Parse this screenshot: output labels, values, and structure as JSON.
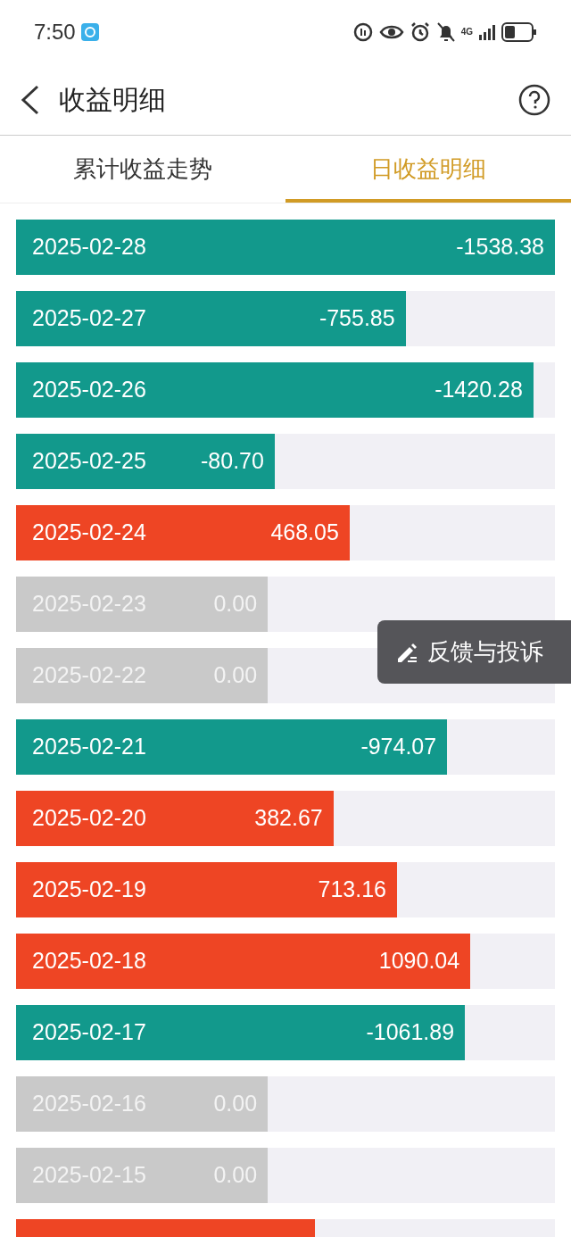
{
  "status_bar": {
    "time": "7:50",
    "network": "4G"
  },
  "header": {
    "title": "收益明细"
  },
  "tabs": [
    {
      "label": "累计收益走势",
      "selected": false
    },
    {
      "label": "日收益明细",
      "selected": true
    }
  ],
  "rows": [
    {
      "date": "2025-02-28",
      "value": "-1538.38",
      "kind": "loss",
      "level": 1.0
    },
    {
      "date": "2025-02-27",
      "value": "-755.85",
      "kind": "loss",
      "level": 0.723
    },
    {
      "date": "2025-02-26",
      "value": "-1420.28",
      "kind": "loss",
      "level": 0.96
    },
    {
      "date": "2025-02-25",
      "value": "-80.70",
      "kind": "loss",
      "level": 0.48
    },
    {
      "date": "2025-02-24",
      "value": "468.05",
      "kind": "gain",
      "level": 0.619
    },
    {
      "date": "2025-02-23",
      "value": "0.00",
      "kind": "zero",
      "level": 0.467
    },
    {
      "date": "2025-02-22",
      "value": "0.00",
      "kind": "zero",
      "level": 0.467
    },
    {
      "date": "2025-02-21",
      "value": "-974.07",
      "kind": "loss",
      "level": 0.8
    },
    {
      "date": "2025-02-20",
      "value": "382.67",
      "kind": "gain",
      "level": 0.589
    },
    {
      "date": "2025-02-19",
      "value": "713.16",
      "kind": "gain",
      "level": 0.707
    },
    {
      "date": "2025-02-18",
      "value": "1090.04",
      "kind": "gain",
      "level": 0.843
    },
    {
      "date": "2025-02-17",
      "value": "-1061.89",
      "kind": "loss",
      "level": 0.833
    },
    {
      "date": "2025-02-16",
      "value": "0.00",
      "kind": "zero",
      "level": 0.467
    },
    {
      "date": "2025-02-15",
      "value": "0.00",
      "kind": "zero",
      "level": 0.467
    },
    {
      "kind": "gain",
      "level": 0.555
    }
  ],
  "feedback_button": {
    "label": "反馈与投诉"
  }
}
